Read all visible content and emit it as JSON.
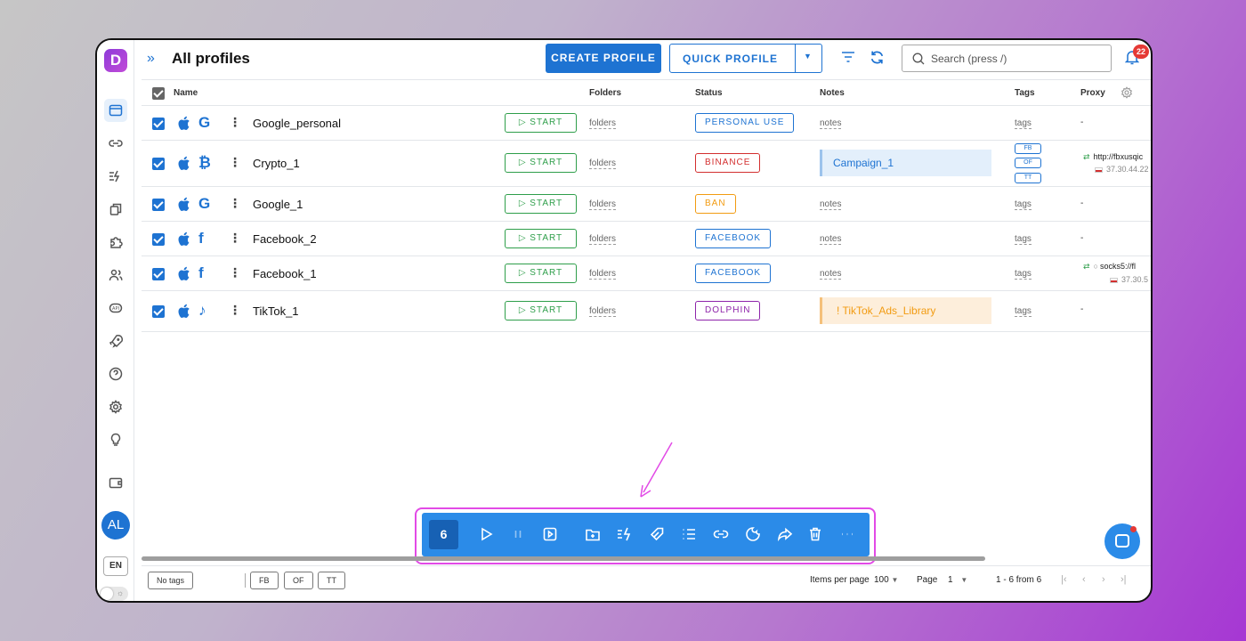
{
  "app": {
    "logo_letter": "D",
    "brand_color": "#1e73d2",
    "accent_purple": "#9b3fd8"
  },
  "header": {
    "expand_glyph": "»",
    "title": "All profiles",
    "create_profile": "CREATE PROFILE",
    "quick_profile": "QUICK PROFILE",
    "search_placeholder": "Search (press /)",
    "notifications_count": "22"
  },
  "sidebar": {
    "items": [
      {
        "icon": "browser-window-icon",
        "active": true
      },
      {
        "icon": "link-icon"
      },
      {
        "icon": "automation-icon"
      },
      {
        "icon": "copy-icon"
      },
      {
        "icon": "extension-puzzle-icon"
      },
      {
        "icon": "team-users-icon"
      },
      {
        "icon": "api-icon",
        "label": "API"
      },
      {
        "icon": "rocket-icon"
      },
      {
        "icon": "help-icon"
      },
      {
        "icon": "settings-gear-icon"
      },
      {
        "icon": "lightbulb-icon"
      },
      {
        "icon": "wallet-icon"
      }
    ],
    "avatar": "AL",
    "language": "EN"
  },
  "table": {
    "columns": {
      "name": "Name",
      "folders": "Folders",
      "status": "Status",
      "notes": "Notes",
      "tags": "Tags",
      "proxy": "Proxy"
    },
    "rows": [
      {
        "name": "Google_personal",
        "site": "G",
        "site_icon": "google-icon",
        "start": "▷ START",
        "folders": "folders",
        "status": "PERSONAL USE",
        "status_color": "#1e73d2",
        "notes": "notes",
        "tags": "tags",
        "proxy": "-"
      },
      {
        "name": "Crypto_1",
        "site": "₿",
        "site_icon": "bitcoin-icon",
        "start": "▷ START",
        "folders": "folders",
        "status": "BINANCE",
        "status_color": "#d32f2f",
        "notes_box": "Campaign_1",
        "tag_chips": [
          "FB",
          "OF",
          "TT"
        ],
        "proxy_url": "http://fbxusqic",
        "proxy_ip": "37.30.44.22"
      },
      {
        "name": "Google_1",
        "site": "G",
        "site_icon": "google-icon",
        "start": "▷ START",
        "folders": "folders",
        "status": "BAN",
        "status_color": "#f29b11",
        "notes": "notes",
        "tags": "tags",
        "proxy": "-"
      },
      {
        "name": "Facebook_2",
        "site": "f",
        "site_icon": "facebook-icon",
        "start": "▷ START",
        "folders": "folders",
        "status": "FACEBOOK",
        "status_color": "#1e73d2",
        "notes": "notes",
        "tags": "tags",
        "proxy": "-"
      },
      {
        "name": "Facebook_1",
        "site": "f",
        "site_icon": "facebook-icon",
        "start": "▷ START",
        "folders": "folders",
        "status": "FACEBOOK",
        "status_color": "#1e73d2",
        "notes": "notes",
        "tags": "tags",
        "proxy_url": "socks5://fl",
        "proxy_ip": "37.30.5"
      },
      {
        "name": "TikTok_1",
        "site": "♪",
        "site_icon": "tiktok-icon",
        "start": "▷ START",
        "folders": "folders",
        "status": "DOLPHIN",
        "status_color": "#8e24aa",
        "notes_box": "!  TikTok_Ads_Library",
        "tags": "tags",
        "proxy": "-"
      }
    ]
  },
  "bulk_bar": {
    "selected_count": "6",
    "actions": [
      "play-icon",
      "pause-icon",
      "video-icon",
      "add-folder-icon",
      "automation-icon",
      "tag-icon",
      "list-icon",
      "link-icon",
      "cookie-icon",
      "share-icon",
      "trash-icon",
      "more-icon"
    ]
  },
  "footer": {
    "tag_filters": [
      "No tags",
      "FB",
      "OF",
      "TT"
    ],
    "items_per_page_label": "Items per page",
    "items_per_page": "100",
    "page_label": "Page",
    "page": "1",
    "range": "1 - 6 from 6"
  }
}
